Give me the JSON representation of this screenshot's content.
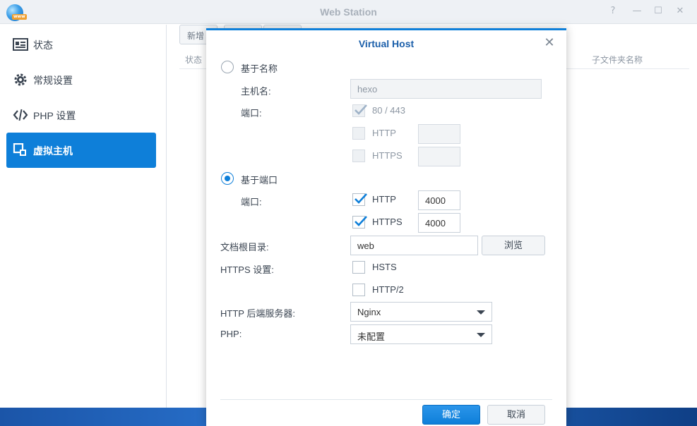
{
  "window": {
    "title": "Web Station",
    "controls": {
      "help": "?",
      "minimize": "—",
      "maximize": "☐",
      "close": "✕"
    }
  },
  "sidebar": {
    "items": [
      {
        "label": "状态",
        "icon": "status-card-icon",
        "active": false
      },
      {
        "label": "常规设置",
        "icon": "gear-icon",
        "active": false
      },
      {
        "label": "PHP 设置",
        "icon": "code-icon",
        "active": false
      },
      {
        "label": "虚拟主机",
        "icon": "virtual-host-icon",
        "active": true
      }
    ]
  },
  "content": {
    "toolbar": {
      "new_label": "新增"
    },
    "grid_columns": {
      "status": "状态",
      "subfolder": "子文件夹名称"
    }
  },
  "dialog": {
    "title": "Virtual Host",
    "close_glyph": "✕",
    "name_based": {
      "label": "基于名称",
      "selected": false,
      "hostname_label": "主机名:",
      "hostname_value": "hexo",
      "port_label": "端口:",
      "default_port_label": "80 / 443",
      "default_port_checked": true,
      "http_label": "HTTP",
      "http_value": "",
      "https_label": "HTTPS",
      "https_value": ""
    },
    "port_based": {
      "label": "基于端口",
      "selected": true,
      "port_label": "端口:",
      "http_label": "HTTP",
      "http_checked": true,
      "http_value": "4000",
      "https_label": "HTTPS",
      "https_checked": true,
      "https_value": "4000"
    },
    "doc_root": {
      "label": "文档根目录:",
      "value": "web",
      "browse_label": "浏览"
    },
    "https_settings": {
      "label": "HTTPS 设置:",
      "hsts_label": "HSTS",
      "hsts_checked": false,
      "http2_label": "HTTP/2",
      "http2_checked": false
    },
    "backend": {
      "label": "HTTP 后端服务器:",
      "value": "Nginx"
    },
    "php": {
      "label": "PHP:",
      "value": "未配置"
    },
    "footer": {
      "ok_label": "确定",
      "cancel_label": "取消"
    }
  },
  "colors": {
    "accent": "#0e7fd9",
    "title_blue": "#1b5faa",
    "sidebar_active": "#0e7fd9"
  }
}
